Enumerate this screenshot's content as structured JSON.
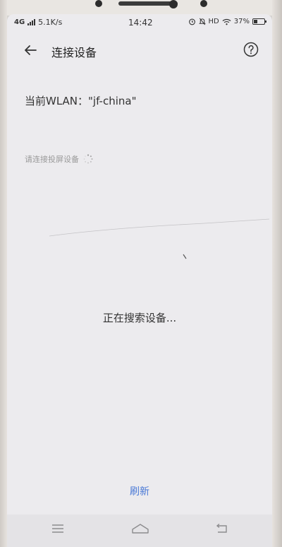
{
  "status_bar": {
    "network": "4G",
    "speed": "5.1K/s",
    "time": "14:42",
    "hd": "HD",
    "battery_percent": "37%",
    "battery_level": 0.37
  },
  "header": {
    "title": "连接设备",
    "back_icon": "arrow-left-icon",
    "help_icon": "help-circle-icon"
  },
  "wlan": {
    "label": "当前WLAN：\"jf-china\""
  },
  "hint": {
    "text": "请连接投屏设备"
  },
  "main": {
    "searching_text": "正在搜索设备..."
  },
  "footer": {
    "refresh_label": "刷新"
  },
  "colors": {
    "accent": "#4a79d6",
    "background": "#ecebee"
  }
}
